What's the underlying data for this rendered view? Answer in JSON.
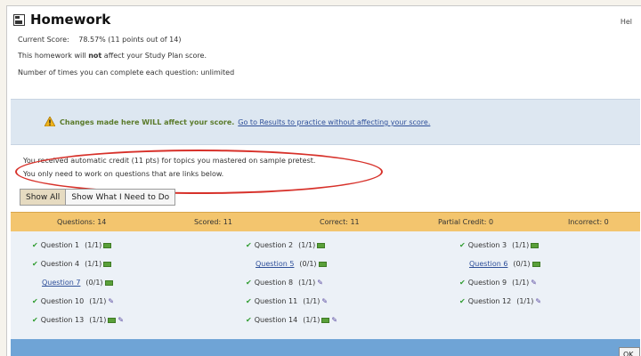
{
  "header": {
    "title": "Homework",
    "help_link": "Hel"
  },
  "info": {
    "current_score_label": "Current Score:",
    "current_score_value": "78.57% (11 points out of 14)",
    "study_plan_prefix": "This homework will ",
    "study_plan_bold": "not",
    "study_plan_suffix": " affect your Study Plan score.",
    "attempts_text": "Number of times you can complete each question: unlimited"
  },
  "banner": {
    "text": "Changes made here WILL affect your score.",
    "link": "Go to Results to practice without affecting your score."
  },
  "auto_credit": {
    "line1": "You received automatic credit (11 pts) for topics you mastered on sample pretest.",
    "line2": "You only need to work on questions that are links below."
  },
  "tabs": [
    {
      "label": "Show All"
    },
    {
      "label": "Show What I Need to Do"
    }
  ],
  "summary": {
    "questions": "Questions: 14",
    "scored": "Scored: 11",
    "correct": "Correct: 11",
    "partial": "Partial Credit: 0",
    "incorrect": "Incorrect: 0"
  },
  "questions": [
    {
      "label": "Question 1",
      "score": "(1/1)",
      "done": true,
      "icons": [
        "help-icon"
      ]
    },
    {
      "label": "Question 2",
      "score": "(1/1)",
      "done": true,
      "icons": [
        "help-icon"
      ]
    },
    {
      "label": "Question 3",
      "score": "(1/1)",
      "done": true,
      "icons": [
        "help-icon"
      ]
    },
    {
      "label": "Question 4",
      "score": "(1/1)",
      "done": true,
      "icons": [
        "help-icon"
      ]
    },
    {
      "label": "Question 5",
      "score": "(0/1)",
      "done": false,
      "icons": [
        "help-icon"
      ]
    },
    {
      "label": "Question 6",
      "score": "(0/1)",
      "done": false,
      "icons": [
        "help-icon"
      ]
    },
    {
      "label": "Question 7",
      "score": "(0/1)",
      "done": false,
      "icons": [
        "help-icon"
      ]
    },
    {
      "label": "Question 8",
      "score": "(1/1)",
      "done": true,
      "icons": [
        "edit-icon"
      ]
    },
    {
      "label": "Question 9",
      "score": "(1/1)",
      "done": true,
      "icons": [
        "edit-icon"
      ]
    },
    {
      "label": "Question 10",
      "score": "(1/1)",
      "done": true,
      "icons": [
        "edit-icon"
      ]
    },
    {
      "label": "Question 11",
      "score": "(1/1)",
      "done": true,
      "icons": [
        "edit-icon"
      ]
    },
    {
      "label": "Question 12",
      "score": "(1/1)",
      "done": true,
      "icons": [
        "edit-icon"
      ]
    },
    {
      "label": "Question 13",
      "score": "(1/1)",
      "done": true,
      "icons": [
        "help-icon",
        "edit-icon"
      ]
    },
    {
      "label": "Question 14",
      "score": "(1/1)",
      "done": true,
      "icons": [
        "help-icon",
        "edit-icon"
      ]
    }
  ],
  "footer": {
    "ok_label": "OK"
  },
  "colors": {
    "summary_bar": "#f3c56e",
    "banner": "#dde7f1",
    "grid": "#ecf1f7",
    "footer": "#6fa4d6",
    "highlight_ellipse": "#d7312a",
    "check": "#2f9c2f",
    "link": "#2e4f99"
  }
}
